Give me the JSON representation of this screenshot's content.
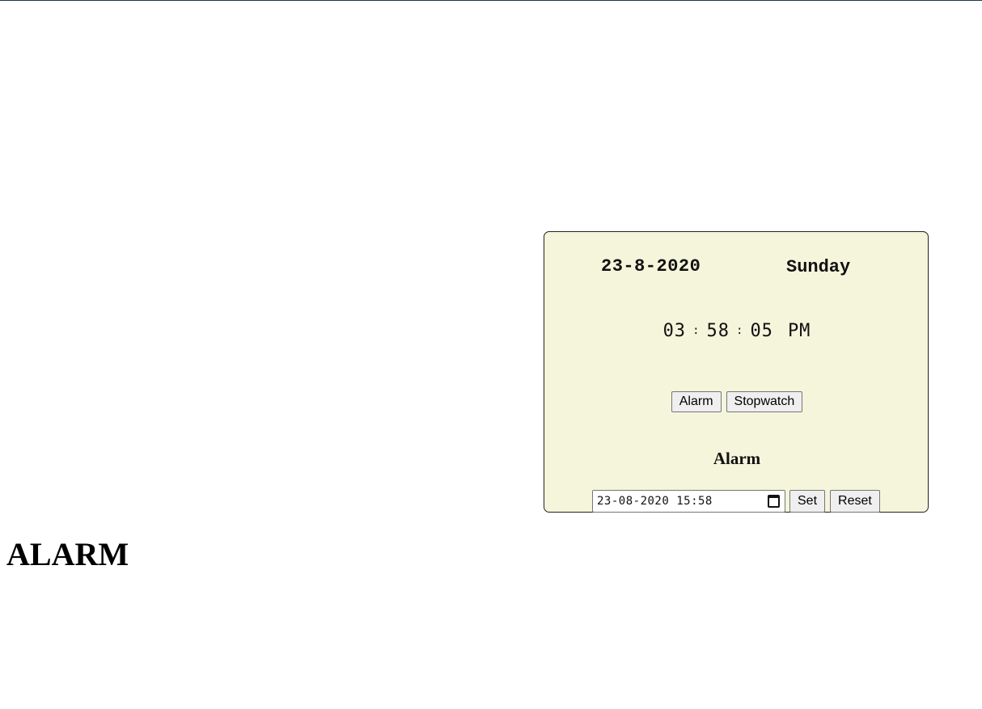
{
  "clock": {
    "date": "23-8-2020",
    "day": "Sunday",
    "hours": "03",
    "minutes": "58",
    "seconds": "05",
    "separator": ":",
    "ampm": "PM"
  },
  "modes": {
    "alarm_label": "Alarm",
    "stopwatch_label": "Stopwatch"
  },
  "alarm": {
    "heading": "Alarm",
    "datetime_value": "23-08-2020 15:58",
    "set_label": "Set",
    "reset_label": "Reset"
  },
  "page": {
    "title": "ALARM"
  },
  "icons": {
    "calendar": "calendar-icon"
  },
  "colors": {
    "panel_bg": "#f5f5dc",
    "top_border": "#1b3a4b"
  }
}
